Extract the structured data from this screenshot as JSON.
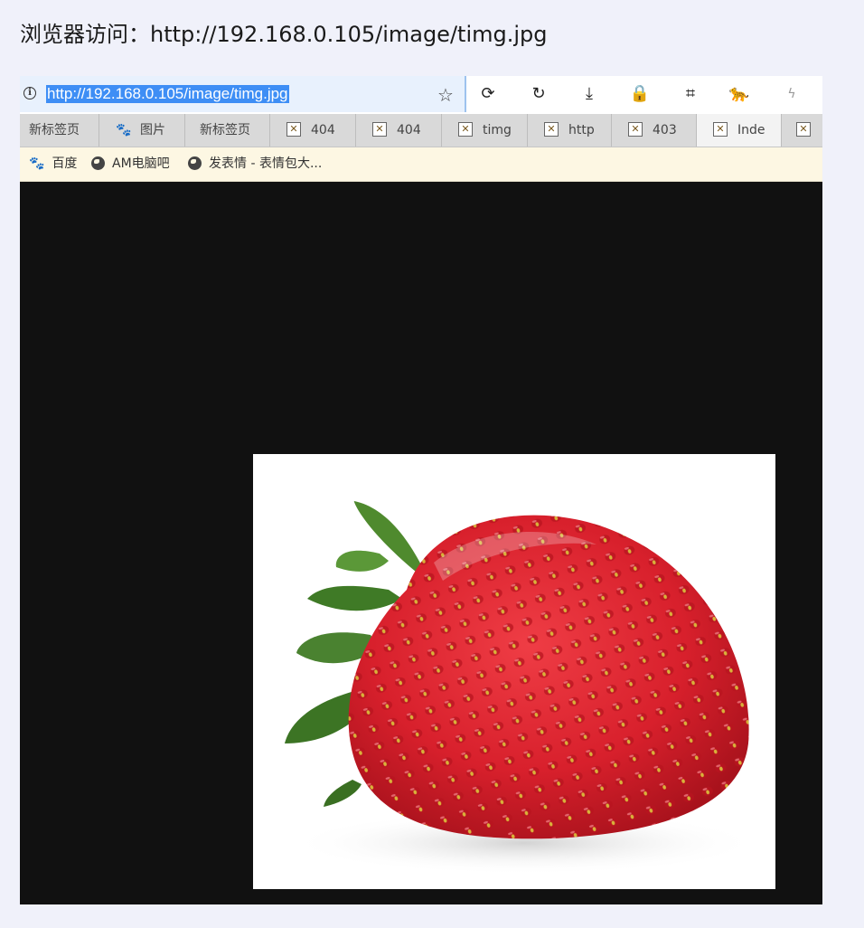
{
  "heading": "浏览器访问：http://192.168.0.105/image/timg.jpg",
  "toolbar": {
    "url": "http://192.168.0.105/image/timg.jpg",
    "icons": [
      "info-icon",
      "star-icon",
      "refresh-icon",
      "undo-icon",
      "download-icon",
      "lock-icon",
      "crop-icon",
      "extension-icon",
      "flash-icon"
    ]
  },
  "tabs": [
    {
      "label": "新标签页",
      "icon": "none"
    },
    {
      "label": "图片",
      "icon": "baidu-paw-icon"
    },
    {
      "label": "新标签页",
      "icon": "none"
    },
    {
      "label": "404",
      "icon": "broken-image-icon"
    },
    {
      "label": "404",
      "icon": "broken-image-icon"
    },
    {
      "label": "timg",
      "icon": "broken-image-icon"
    },
    {
      "label": "http",
      "icon": "broken-image-icon"
    },
    {
      "label": "403",
      "icon": "broken-image-icon"
    },
    {
      "label": "Inde",
      "icon": "broken-image-icon",
      "active": true
    },
    {
      "label": "",
      "icon": "broken-image-icon"
    }
  ],
  "bookmarks": [
    {
      "label": "百度",
      "icon": "baidu-paw-icon"
    },
    {
      "label": "AM电脑吧",
      "icon": "globe-icon"
    },
    {
      "label": "发表情 - 表情包大...",
      "icon": "globe-icon"
    }
  ],
  "viewer": {
    "image_subject": "strawberry",
    "background": "#111111"
  }
}
